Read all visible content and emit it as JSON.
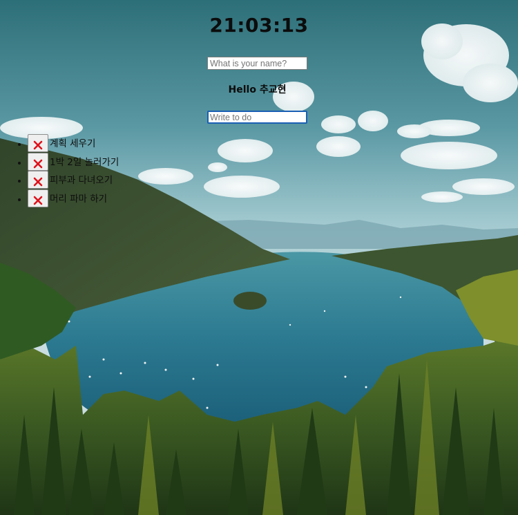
{
  "clock": {
    "time": "21:03:13"
  },
  "name_input": {
    "placeholder": "What is your name?",
    "value": ""
  },
  "greeting": {
    "text": "Hello 추교현"
  },
  "todo_input": {
    "placeholder": "Write to do",
    "value": ""
  },
  "todos": [
    {
      "text": "계획 세우기",
      "delete_icon": "close-x-icon"
    },
    {
      "text": "1박 2일 놀러가기",
      "delete_icon": "close-x-icon"
    },
    {
      "text": "피부과 다녀오기",
      "delete_icon": "close-x-icon"
    },
    {
      "text": "머리 파마 하기",
      "delete_icon": "close-x-icon"
    }
  ],
  "colors": {
    "delete_x": "#e0111b",
    "input_focus_border": "#1a5fb4",
    "water": "#2f7f95",
    "forest": "#2d4a22"
  }
}
